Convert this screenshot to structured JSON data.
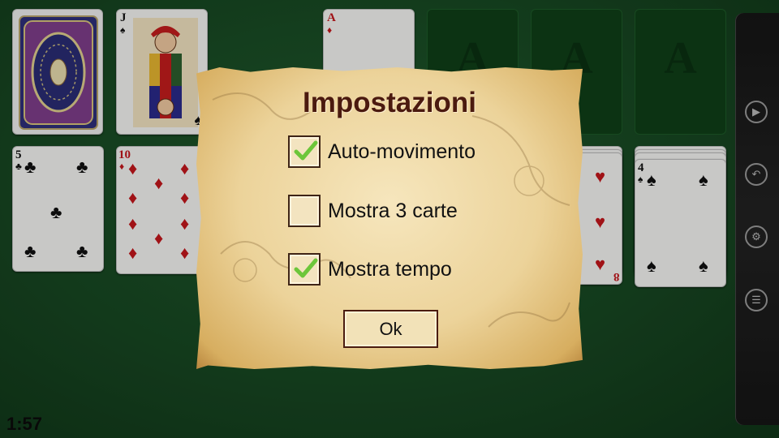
{
  "game": {
    "timer": "1:57",
    "stock_card": {
      "rank": "J",
      "suit": "♠"
    },
    "foundation_top": {
      "rank": "A",
      "suit": "♦"
    },
    "tableau": [
      {
        "rank": "5",
        "suit": "♣"
      },
      {
        "rank": "10",
        "suit": "♦"
      },
      {
        "rank": "8",
        "suit": "♥"
      },
      {
        "rank": "4",
        "suit": "♠"
      }
    ]
  },
  "sidebar": {
    "icons": [
      "play-icon",
      "undo-icon",
      "settings-icon",
      "menu-list-icon"
    ]
  },
  "dialog": {
    "title": "Impostazioni",
    "options": [
      {
        "label": "Auto-movimento",
        "checked": true
      },
      {
        "label": "Mostra 3 carte",
        "checked": false
      },
      {
        "label": "Mostra tempo",
        "checked": true
      }
    ],
    "ok_label": "Ok"
  },
  "colors": {
    "felt": "#174722",
    "dialog_title": "#4b1a0f",
    "check_green": "#6cc63a"
  }
}
